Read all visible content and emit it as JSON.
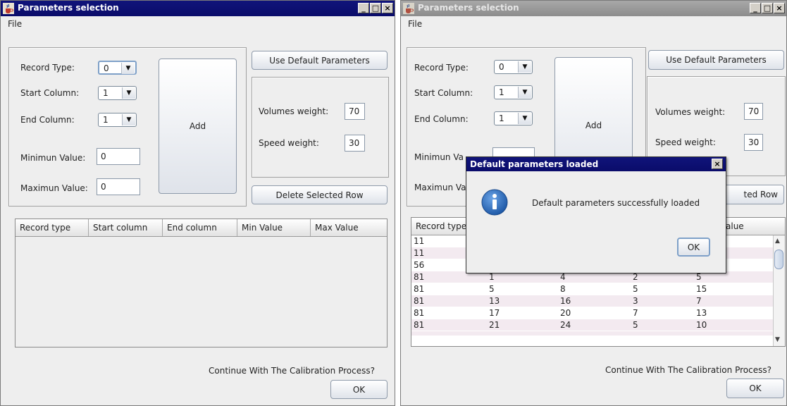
{
  "left_window": {
    "title": "Parameters selection",
    "menu": [
      "File"
    ],
    "form": {
      "record_type_label": "Record Type:",
      "record_type_value": "0",
      "start_column_label": "Start Column:",
      "start_column_value": "1",
      "end_column_label": "End Column:",
      "end_column_value": "1",
      "min_label": "Minimun Value:",
      "min_value": "0",
      "max_label": "Maximun Value:",
      "max_value": "0",
      "add_label": "Add"
    },
    "weights": {
      "use_default_label": "Use Default Parameters",
      "volumes_label": "Volumes weight:",
      "volumes_value": "70",
      "speed_label": "Speed weight:",
      "speed_value": "30",
      "delete_label": "Delete Selected Row"
    },
    "table": {
      "columns": [
        "Record type",
        "Start column",
        "End column",
        "Min Value",
        "Max Value"
      ],
      "rows": []
    },
    "footer": {
      "question": "Continue With The Calibration Process?",
      "ok_label": "OK"
    }
  },
  "right_window": {
    "title": "Parameters selection",
    "menu": [
      "File"
    ],
    "form": {
      "record_type_label": "Record Type:",
      "record_type_value": "0",
      "start_column_label": "Start Column:",
      "start_column_value": "1",
      "end_column_label": "End Column:",
      "end_column_value": "1",
      "min_label_partial": "Minimun Va",
      "max_label_partial": "Maximun Va",
      "add_label": "Add"
    },
    "weights": {
      "use_default_label": "Use Default Parameters",
      "volumes_label": "Volumes weight:",
      "volumes_value": "70",
      "speed_label": "Speed weight:",
      "speed_value": "30",
      "delete_label_partial": "ted Row"
    },
    "table": {
      "col_first": "Record type",
      "col_last_partial": "alue",
      "rows": [
        [
          "11",
          "",
          "",
          "",
          ""
        ],
        [
          "11",
          "",
          "",
          "",
          ""
        ],
        [
          "56",
          "",
          "",
          "",
          ""
        ],
        [
          "81",
          "1",
          "4",
          "2",
          "5"
        ],
        [
          "81",
          "5",
          "8",
          "5",
          "15"
        ],
        [
          "81",
          "13",
          "16",
          "3",
          "7"
        ],
        [
          "81",
          "17",
          "20",
          "7",
          "13"
        ],
        [
          "81",
          "21",
          "24",
          "5",
          "10"
        ]
      ]
    },
    "footer": {
      "question": "Continue With The Calibration Process?",
      "ok_label": "OK"
    }
  },
  "dialog": {
    "title": "Default parameters loaded",
    "message": "Default parameters successfully loaded",
    "ok_label": "OK",
    "icon": "info-icon"
  },
  "colors": {
    "active_title": "#10147a",
    "inactive_title": "#9a9a9a",
    "window_bg": "#eeeeee",
    "info_blue": "#2f6fc2",
    "row_stripe": "#f3eaf0"
  }
}
